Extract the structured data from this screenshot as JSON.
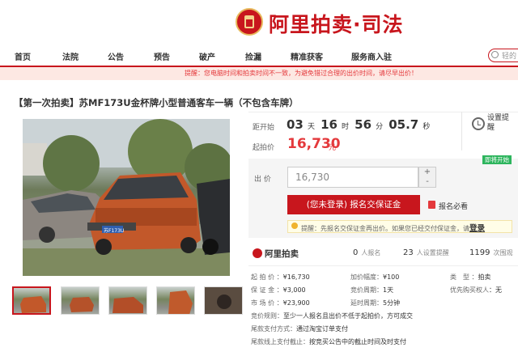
{
  "header": {
    "logo_text": "阿里拍卖·司法"
  },
  "nav": {
    "items": [
      "首页",
      "法院",
      "公告",
      "预告",
      "破产",
      "捡漏",
      "精准获客",
      "服务商入驻"
    ],
    "search_placeholder": "轻的"
  },
  "notice": "提醒：您电脑时间和拍卖时间不一致，为避免错过合理的出价时间，请尽早出价！",
  "item": {
    "title": "【第一次拍卖】苏MF173U金杯牌小型普通客车一辆（不包含车牌）"
  },
  "countdown": {
    "label": "距开始",
    "days": "03",
    "days_unit": "天",
    "hours": "16",
    "hours_unit": "时",
    "minutes": "56",
    "minutes_unit": "分",
    "seconds": "05.7",
    "seconds_unit": "秒"
  },
  "start_price": {
    "label": "起拍价",
    "value": "16,730",
    "unit": "元"
  },
  "remind": {
    "label": "设置提醒"
  },
  "status_badge": "即将开始",
  "bid": {
    "label": "出 价",
    "value": "16,730",
    "plus": "+",
    "minus": "-"
  },
  "signup_button": "(您未登录) 报名交保证金",
  "must_read": "报名必看",
  "tip": {
    "text": "提醒：先报名交保证金再出价。如果您已经交付保证金，请",
    "link": "登录"
  },
  "brand": "阿里拍卖",
  "stats": {
    "signups": {
      "value": "0",
      "label": "人报名"
    },
    "reminders": {
      "value": "23",
      "label": "人设置提醒"
    },
    "views": {
      "value": "1199",
      "label": "次围观"
    }
  },
  "details": {
    "start_price": {
      "label": "起 拍 价 ：",
      "value": "¥16,730"
    },
    "increment": {
      "label": "加价幅度：",
      "value": "¥100"
    },
    "type": {
      "label": "类　型 ：",
      "value": "拍卖"
    },
    "deposit": {
      "label": "保 证 金 ：",
      "value": "¥3,000"
    },
    "bid_cycle": {
      "label": "竞价周期：",
      "value": "1天"
    },
    "priority": {
      "label": "优先购买权人",
      "value": "：无"
    },
    "market_price": {
      "label": "市 场 价 ：",
      "value": "¥23,900"
    },
    "delay_cycle": {
      "label": "延时周期：",
      "value": "5分钟"
    },
    "rule": {
      "label": "竞价规则：",
      "value": "至少一人报名且出价不低于起拍价，方可成交"
    },
    "final_payment": {
      "label": "尾款支付方式：",
      "value": "通过淘宝订单支付"
    },
    "offline_deadline": {
      "label": "尾款线上支付截止：",
      "value": "按竞买公告中的截止时间及时支付"
    }
  },
  "colors": {
    "brand_red": "#c8161d",
    "price_red": "#e4393c",
    "status_green": "#2db55d"
  },
  "photo": {
    "plate_text": "苏F173U"
  }
}
